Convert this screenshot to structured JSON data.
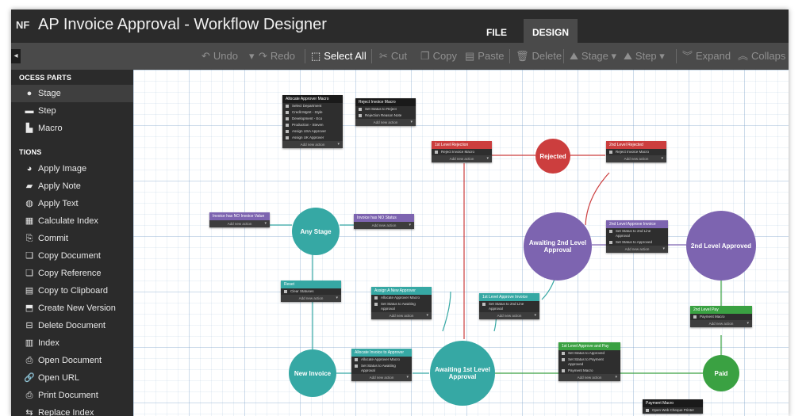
{
  "window": {
    "title": "AP Invoice Approval - Workflow Designer",
    "logo": "NF"
  },
  "tabs": [
    {
      "label": "FILE"
    },
    {
      "label": "DESIGN"
    }
  ],
  "toolbar": {
    "undo": "Undo",
    "redo": "Redo",
    "select_all": "Select All",
    "cut": "Cut",
    "copy": "Copy",
    "paste": "Paste",
    "delete": "Delete",
    "stage": "Stage",
    "step": "Step",
    "expand": "Expand",
    "collapse": "Collaps"
  },
  "sidebar": {
    "process_parts_header": "OCESS PARTS",
    "process_parts": [
      {
        "label": "Stage",
        "icon": "circle-icon"
      },
      {
        "label": "Step",
        "icon": "step-icon"
      },
      {
        "label": "Macro",
        "icon": "macro-icon"
      }
    ],
    "actions_header": "TIONS",
    "actions": [
      {
        "label": "Apply Image",
        "icon": "apply-image-icon"
      },
      {
        "label": "Apply Note",
        "icon": "apply-note-icon"
      },
      {
        "label": "Apply Text",
        "icon": "apply-text-icon"
      },
      {
        "label": "Calculate Index",
        "icon": "calculate-index-icon"
      },
      {
        "label": "Commit",
        "icon": "commit-icon"
      },
      {
        "label": "Copy Document",
        "icon": "copy-document-icon"
      },
      {
        "label": "Copy Reference",
        "icon": "copy-reference-icon"
      },
      {
        "label": "Copy to Clipboard",
        "icon": "clipboard-icon"
      },
      {
        "label": "Create New Version",
        "icon": "new-version-icon"
      },
      {
        "label": "Delete Document",
        "icon": "trash-icon"
      },
      {
        "label": "Index",
        "icon": "index-icon"
      },
      {
        "label": "Open Document",
        "icon": "open-document-icon"
      },
      {
        "label": "Open URL",
        "icon": "link-icon"
      },
      {
        "label": "Print Document",
        "icon": "printer-icon"
      },
      {
        "label": "Replace Index",
        "icon": "replace-index-icon"
      }
    ]
  },
  "canvas": {
    "stages": {
      "any_stage": "Any Stage",
      "new_invoice": "New Invoice",
      "awaiting_1st": "Awaiting 1st Level Approval",
      "rejected": "Rejected",
      "awaiting_2nd": "Awaiting 2nd Level Approval",
      "approved_2nd": "2nd Level Approved",
      "paid": "Paid"
    },
    "add_action": "Add new action",
    "macros": {
      "allocate_approver": {
        "title": "Allocate Approver Macro",
        "rows": [
          "Select Department",
          "Credit Mgmt - Style",
          "Development - Eco",
          "Production - Steven",
          "Assign USA Approver",
          "Assign UK Approver"
        ]
      },
      "reject_invoice": {
        "title": "Reject Invoice Macro",
        "rows": [
          "Set Status to Reject",
          "Rejection Reason Note"
        ]
      },
      "payment": {
        "title": "Payment Macro",
        "rows": [
          "Open Web Cheque Printer"
        ]
      }
    },
    "steps": {
      "invoice_has_no_invoice_value": {
        "title": "Invoice has NO Invoice Value",
        "rows": []
      },
      "invoice_has_no_status": {
        "title": "Invoice has NO Status",
        "rows": []
      },
      "reset": {
        "title": "Reset",
        "rows": [
          "Clear Statuses"
        ]
      },
      "assign_new_approver": {
        "title": "Assign A New Approver",
        "rows": [
          "Allocate Approver Macro",
          "Set Status to Awaiting Approval"
        ]
      },
      "allocate_invoice": {
        "title": "Allocate Invoice to Approver",
        "rows": [
          "Allocate Approver Macro",
          "Set Status to Awaiting Approval"
        ]
      },
      "first_level_reject": {
        "title": "1st Level Rejection",
        "rows": [
          "Reject Invoice Macro"
        ]
      },
      "second_level_reject": {
        "title": "2nd Level Rejected",
        "rows": [
          "Reject Invoice Macro"
        ]
      },
      "first_level_approve": {
        "title": "1st Level Approve Invoice",
        "rows": [
          "Set Status to 2nd Line Approval"
        ]
      },
      "second_level_approve": {
        "title": "2nd Level Approve Invoice",
        "rows": [
          "Set Status to 2nd Line Approval",
          "Set Status to Approved"
        ]
      },
      "first_level_approve_pay": {
        "title": "1st Level Approve and Pay",
        "rows": [
          "Set Status to Approved",
          "Set Status to Payment Approved",
          "Payment Macro"
        ]
      },
      "second_level_pay": {
        "title": "2nd Level Pay",
        "rows": [
          "Payment Macro"
        ]
      }
    }
  },
  "colors": {
    "teal": "#36a8a4",
    "purple": "#7d64b0",
    "red": "#cc3e3e",
    "green": "#3aa142",
    "dark": "#2b2b2b"
  }
}
